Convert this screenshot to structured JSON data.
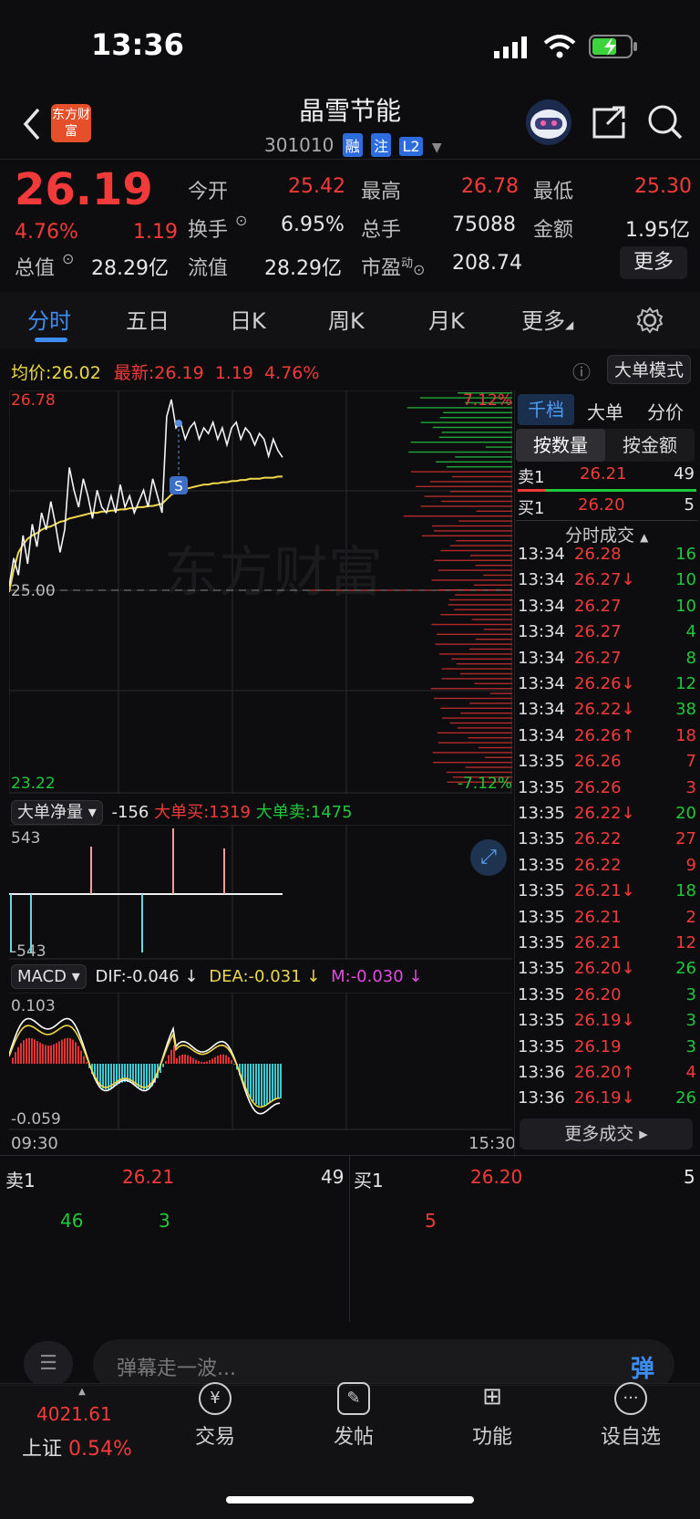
{
  "status_bar": {
    "time": "13:36"
  },
  "header": {
    "title": "晶雪节能",
    "code": "301010",
    "tags": [
      "融",
      "注",
      "L2"
    ]
  },
  "quote": {
    "price": "26.19",
    "change_pct": "4.76%",
    "change": "1.19",
    "open_label": "今开",
    "open": "25.42",
    "high_label": "最高",
    "high": "26.78",
    "low_label": "最低",
    "low": "25.30",
    "turnover_label": "换手",
    "turnover": "6.95%",
    "volume_label": "总手",
    "volume": "75088",
    "amount_label": "金额",
    "amount": "1.95亿",
    "mktcap_label": "总值",
    "mktcap": "28.29亿",
    "float_label": "流值",
    "float": "28.29亿",
    "pe_label": "市盈",
    "pe_sup": "动",
    "pe": "208.74",
    "more_button": "更多"
  },
  "tabs": [
    "分时",
    "五日",
    "日K",
    "周K",
    "月K",
    "更多"
  ],
  "chart_header": {
    "avg_label": "均价:",
    "avg": "26.02",
    "latest_label": "最新:",
    "latest": "26.19",
    "latest_chg": "1.19",
    "latest_pct": "4.76%",
    "big_order_mode": "大单模式"
  },
  "chart_data": {
    "type": "line",
    "y_top": "26.78",
    "y_mid": "25.00",
    "y_bottom": "23.22",
    "pct_top": "7.12%",
    "pct_bottom": "-7.12%",
    "ylim": [
      23.22,
      26.78
    ],
    "series": [
      {
        "values": [
          25.05,
          25.3,
          25.15,
          25.5,
          25.25,
          25.6,
          25.4,
          25.7,
          25.55,
          25.8,
          25.6,
          25.35,
          25.55,
          26.1,
          25.9,
          25.75,
          26.0,
          25.85,
          25.65,
          25.9,
          25.75,
          25.7,
          25.85,
          25.7,
          25.95,
          25.75,
          25.85,
          25.7,
          25.8,
          25.9,
          25.75,
          26.0,
          25.85,
          25.7,
          26.55,
          26.7,
          26.45,
          26.5,
          26.35,
          26.45,
          26.5,
          26.35,
          26.45,
          26.4,
          26.5,
          26.35,
          26.45,
          26.3,
          26.45,
          26.5,
          26.35,
          26.45,
          26.4,
          26.3,
          26.4,
          26.35,
          26.2,
          26.35,
          26.25,
          26.19
        ]
      },
      {
        "values": [
          25.0,
          25.2,
          25.35,
          25.42,
          25.47,
          25.5,
          25.52,
          25.55,
          25.57,
          25.58,
          25.6,
          25.62,
          25.63,
          25.65,
          25.66,
          25.67,
          25.68,
          25.69,
          25.7,
          25.7,
          25.71,
          25.71,
          25.72,
          25.72,
          25.73,
          25.73,
          25.74,
          25.74,
          25.75,
          25.75,
          25.76,
          25.76,
          25.77,
          25.78,
          25.82,
          25.86,
          25.88,
          25.9,
          25.91,
          25.92,
          25.93,
          25.94,
          25.95,
          25.95,
          25.96,
          25.96,
          25.97,
          25.97,
          25.98,
          25.98,
          25.99,
          25.99,
          26.0,
          26.0,
          26.0,
          26.01,
          26.01,
          26.01,
          26.02,
          26.02
        ]
      }
    ],
    "x_start": "09:30",
    "x_end": "15:30"
  },
  "big_order": {
    "label": "大单净量",
    "net": "-156",
    "buy": "大单买:1319",
    "sell": "大单卖:1475",
    "y_top": "543",
    "y_bottom": "-543"
  },
  "macd": {
    "label": "MACD",
    "dif": "DIF:-0.046 ↓",
    "dea": "DEA:-0.031 ↓",
    "m": "M:-0.030 ↓",
    "y_top": "0.103",
    "y_bottom": "-0.059"
  },
  "right_panel": {
    "tabs": [
      "千档",
      "大单",
      "分价"
    ],
    "subtabs": [
      "按数量",
      "按金额"
    ],
    "sell1": {
      "label": "卖1",
      "price": "26.21",
      "vol": "49"
    },
    "buy1": {
      "label": "买1",
      "price": "26.20",
      "vol": "5"
    },
    "trades_title": "分时成交",
    "trades": [
      {
        "t": "13:34",
        "p": "26.28",
        "v": "16",
        "pc": "red",
        "vc": "green"
      },
      {
        "t": "13:34",
        "p": "26.27↓",
        "v": "10",
        "pc": "red",
        "vc": "green"
      },
      {
        "t": "13:34",
        "p": "26.27",
        "v": "10",
        "pc": "red",
        "vc": "green"
      },
      {
        "t": "13:34",
        "p": "26.27",
        "v": "4",
        "pc": "red",
        "vc": "green"
      },
      {
        "t": "13:34",
        "p": "26.27",
        "v": "8",
        "pc": "red",
        "vc": "green"
      },
      {
        "t": "13:34",
        "p": "26.26↓",
        "v": "12",
        "pc": "red",
        "vc": "green"
      },
      {
        "t": "13:34",
        "p": "26.22↓",
        "v": "38",
        "pc": "red",
        "vc": "green"
      },
      {
        "t": "13:34",
        "p": "26.26↑",
        "v": "18",
        "pc": "red",
        "vc": "red"
      },
      {
        "t": "13:35",
        "p": "26.26",
        "v": "7",
        "pc": "red",
        "vc": "red"
      },
      {
        "t": "13:35",
        "p": "26.26",
        "v": "3",
        "pc": "red",
        "vc": "red"
      },
      {
        "t": "13:35",
        "p": "26.22↓",
        "v": "20",
        "pc": "red",
        "vc": "green"
      },
      {
        "t": "13:35",
        "p": "26.22",
        "v": "27",
        "pc": "red",
        "vc": "red"
      },
      {
        "t": "13:35",
        "p": "26.22",
        "v": "9",
        "pc": "red",
        "vc": "red"
      },
      {
        "t": "13:35",
        "p": "26.21↓",
        "v": "18",
        "pc": "red",
        "vc": "green"
      },
      {
        "t": "13:35",
        "p": "26.21",
        "v": "2",
        "pc": "red",
        "vc": "red"
      },
      {
        "t": "13:35",
        "p": "26.21",
        "v": "12",
        "pc": "red",
        "vc": "red"
      },
      {
        "t": "13:35",
        "p": "26.20↓",
        "v": "26",
        "pc": "red",
        "vc": "green"
      },
      {
        "t": "13:35",
        "p": "26.20",
        "v": "3",
        "pc": "red",
        "vc": "green"
      },
      {
        "t": "13:35",
        "p": "26.19↓",
        "v": "3",
        "pc": "red",
        "vc": "green"
      },
      {
        "t": "13:35",
        "p": "26.19",
        "v": "3",
        "pc": "red",
        "vc": "green"
      },
      {
        "t": "13:36",
        "p": "26.20↑",
        "v": "4",
        "pc": "red",
        "vc": "red"
      },
      {
        "t": "13:36",
        "p": "26.19↓",
        "v": "26",
        "pc": "red",
        "vc": "green"
      }
    ],
    "more_trades": "更多成交"
  },
  "order_book": {
    "sell_label": "卖1",
    "sell_price": "26.21",
    "sell_vol": "49",
    "buy_label": "买1",
    "buy_price": "26.20",
    "buy_vol": "5",
    "sell_detail": [
      "46",
      "3"
    ],
    "buy_detail": [
      "5"
    ]
  },
  "comment": {
    "placeholder": "弹幕走一波...",
    "send": "弹"
  },
  "bottom_nav": {
    "index_value": "4021.61",
    "index_name": "上证",
    "index_pct": "0.54%",
    "items": [
      "交易",
      "发帖",
      "功能",
      "设自选"
    ]
  },
  "logo_text": "东方财富",
  "watermark": "东方财富"
}
